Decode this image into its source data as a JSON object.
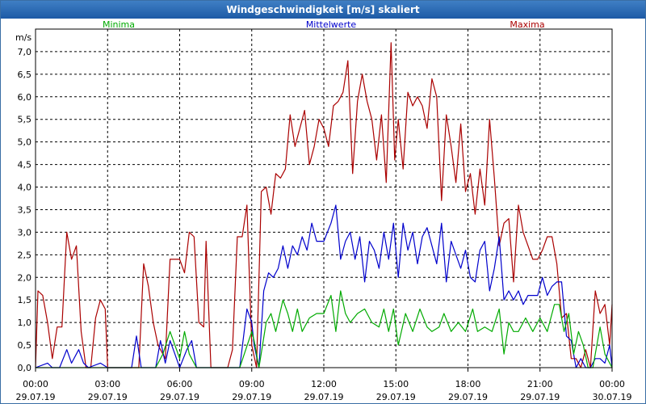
{
  "window": {
    "title": "Windgeschwindigkeit [m/s] skaliert"
  },
  "chart_data": {
    "type": "line",
    "title": "Windgeschwindigkeit [m/s] skaliert",
    "ylabel": "m/s",
    "xlabel": "",
    "ylim": [
      0,
      7.5
    ],
    "xlim": [
      0,
      24
    ],
    "grid": true,
    "legend_position": "top",
    "y_ticks": [
      "0,0",
      "0,5",
      "1,0",
      "1,5",
      "2,0",
      "2,5",
      "3,0",
      "3,5",
      "4,0",
      "4,5",
      "5,0",
      "5,5",
      "6,0",
      "6,5",
      "7,0"
    ],
    "x_ticks": [
      {
        "time": "00:00",
        "date": "29.07.19"
      },
      {
        "time": "03:00",
        "date": "29.07.19"
      },
      {
        "time": "06:00",
        "date": "29.07.19"
      },
      {
        "time": "09:00",
        "date": "29.07.19"
      },
      {
        "time": "12:00",
        "date": "29.07.19"
      },
      {
        "time": "15:00",
        "date": "29.07.19"
      },
      {
        "time": "18:00",
        "date": "29.07.19"
      },
      {
        "time": "21:00",
        "date": "29.07.19"
      },
      {
        "time": "00:00",
        "date": "30.07.19"
      }
    ],
    "series": [
      {
        "name": "Minima",
        "color": "#00aa00",
        "points": [
          [
            0,
            0
          ],
          [
            0.5,
            0
          ],
          [
            1.5,
            0
          ],
          [
            2,
            0
          ],
          [
            2.5,
            0
          ],
          [
            3,
            0
          ],
          [
            4,
            0
          ],
          [
            4.5,
            0
          ],
          [
            5,
            0
          ],
          [
            5.3,
            0.3
          ],
          [
            5.6,
            0.8
          ],
          [
            5.8,
            0.5
          ],
          [
            6,
            0.2
          ],
          [
            6.2,
            0.8
          ],
          [
            6.4,
            0.3
          ],
          [
            6.7,
            0
          ],
          [
            7,
            0
          ],
          [
            8,
            0
          ],
          [
            8.5,
            0
          ],
          [
            9,
            0.8
          ],
          [
            9.1,
            0.6
          ],
          [
            9.3,
            0
          ],
          [
            9.6,
            1
          ],
          [
            9.8,
            1.2
          ],
          [
            10,
            0.8
          ],
          [
            10.3,
            1.5
          ],
          [
            10.5,
            1.2
          ],
          [
            10.7,
            0.8
          ],
          [
            10.9,
            1.3
          ],
          [
            11.1,
            0.8
          ],
          [
            11.4,
            1.1
          ],
          [
            11.7,
            1.2
          ],
          [
            12,
            1.2
          ],
          [
            12.3,
            1.6
          ],
          [
            12.5,
            0.8
          ],
          [
            12.7,
            1.7
          ],
          [
            12.9,
            1.2
          ],
          [
            13.1,
            1
          ],
          [
            13.4,
            1.2
          ],
          [
            13.7,
            1.3
          ],
          [
            14,
            1
          ],
          [
            14.3,
            0.9
          ],
          [
            14.5,
            1.3
          ],
          [
            14.7,
            0.8
          ],
          [
            14.9,
            1.3
          ],
          [
            15.1,
            0.5
          ],
          [
            15.4,
            1.2
          ],
          [
            15.7,
            0.8
          ],
          [
            16,
            1.3
          ],
          [
            16.3,
            0.9
          ],
          [
            16.5,
            0.8
          ],
          [
            16.8,
            0.9
          ],
          [
            17,
            1.2
          ],
          [
            17.3,
            0.8
          ],
          [
            17.6,
            1
          ],
          [
            17.9,
            0.8
          ],
          [
            18.2,
            1.3
          ],
          [
            18.4,
            0.8
          ],
          [
            18.7,
            0.9
          ],
          [
            19,
            0.8
          ],
          [
            19.3,
            1.3
          ],
          [
            19.5,
            0.3
          ],
          [
            19.7,
            1
          ],
          [
            19.9,
            0.8
          ],
          [
            20.1,
            0.8
          ],
          [
            20.4,
            1.1
          ],
          [
            20.7,
            0.8
          ],
          [
            21,
            1.1
          ],
          [
            21.3,
            0.8
          ],
          [
            21.6,
            1.4
          ],
          [
            21.8,
            1.4
          ],
          [
            22,
            0.8
          ],
          [
            22.2,
            1.2
          ],
          [
            22.4,
            0.3
          ],
          [
            22.6,
            0.8
          ],
          [
            22.8,
            0.5
          ],
          [
            23,
            0
          ],
          [
            23.2,
            0
          ],
          [
            23.5,
            0.9
          ],
          [
            23.7,
            0.3
          ],
          [
            24,
            0
          ]
        ]
      },
      {
        "name": "Mittelwerte",
        "color": "#0000cc",
        "points": [
          [
            0,
            0
          ],
          [
            0.5,
            0.1
          ],
          [
            0.7,
            0
          ],
          [
            1,
            0
          ],
          [
            1.3,
            0.4
          ],
          [
            1.5,
            0.1
          ],
          [
            1.8,
            0.4
          ],
          [
            2,
            0.1
          ],
          [
            2.2,
            0
          ],
          [
            2.7,
            0.1
          ],
          [
            3,
            0
          ],
          [
            4,
            0
          ],
          [
            4.2,
            0.7
          ],
          [
            4.4,
            0
          ],
          [
            4.6,
            0
          ],
          [
            5,
            0
          ],
          [
            5.2,
            0.6
          ],
          [
            5.4,
            0.1
          ],
          [
            5.6,
            0.6
          ],
          [
            5.8,
            0.3
          ],
          [
            6,
            0
          ],
          [
            6.3,
            0.4
          ],
          [
            6.5,
            0.6
          ],
          [
            6.7,
            0
          ],
          [
            7,
            0
          ],
          [
            8,
            0
          ],
          [
            8.5,
            0
          ],
          [
            8.8,
            1.3
          ],
          [
            9,
            1
          ],
          [
            9.1,
            0.5
          ],
          [
            9.3,
            0
          ],
          [
            9.5,
            1.7
          ],
          [
            9.7,
            2.1
          ],
          [
            9.9,
            2
          ],
          [
            10.1,
            2.2
          ],
          [
            10.3,
            2.7
          ],
          [
            10.5,
            2.2
          ],
          [
            10.7,
            2.7
          ],
          [
            10.9,
            2.5
          ],
          [
            11.1,
            2.9
          ],
          [
            11.3,
            2.6
          ],
          [
            11.5,
            3.2
          ],
          [
            11.7,
            2.8
          ],
          [
            12,
            2.8
          ],
          [
            12.3,
            3.2
          ],
          [
            12.5,
            3.6
          ],
          [
            12.7,
            2.4
          ],
          [
            12.9,
            2.8
          ],
          [
            13.1,
            3
          ],
          [
            13.3,
            2.4
          ],
          [
            13.5,
            2.9
          ],
          [
            13.7,
            1.9
          ],
          [
            13.9,
            2.8
          ],
          [
            14.1,
            2.6
          ],
          [
            14.3,
            2.2
          ],
          [
            14.5,
            3
          ],
          [
            14.7,
            2.4
          ],
          [
            14.9,
            3.2
          ],
          [
            15.1,
            2
          ],
          [
            15.3,
            3.2
          ],
          [
            15.5,
            2.6
          ],
          [
            15.7,
            3
          ],
          [
            15.9,
            2.3
          ],
          [
            16.1,
            2.9
          ],
          [
            16.3,
            3.1
          ],
          [
            16.5,
            2.7
          ],
          [
            16.7,
            2.3
          ],
          [
            16.9,
            3.2
          ],
          [
            17.1,
            1.9
          ],
          [
            17.3,
            2.8
          ],
          [
            17.5,
            2.5
          ],
          [
            17.7,
            2.2
          ],
          [
            17.9,
            2.6
          ],
          [
            18.1,
            2
          ],
          [
            18.3,
            1.9
          ],
          [
            18.5,
            2.6
          ],
          [
            18.7,
            2.8
          ],
          [
            18.9,
            1.7
          ],
          [
            19.1,
            2.2
          ],
          [
            19.3,
            2.9
          ],
          [
            19.5,
            1.5
          ],
          [
            19.7,
            1.7
          ],
          [
            19.9,
            1.5
          ],
          [
            20.1,
            1.7
          ],
          [
            20.3,
            1.4
          ],
          [
            20.5,
            1.6
          ],
          [
            20.7,
            1.6
          ],
          [
            20.9,
            1.6
          ],
          [
            21.1,
            2
          ],
          [
            21.3,
            1.6
          ],
          [
            21.5,
            1.8
          ],
          [
            21.7,
            1.9
          ],
          [
            21.9,
            1.9
          ],
          [
            22.1,
            0.7
          ],
          [
            22.3,
            0.6
          ],
          [
            22.5,
            0
          ],
          [
            22.7,
            0.2
          ],
          [
            22.9,
            0
          ],
          [
            23.1,
            0
          ],
          [
            23.3,
            0.2
          ],
          [
            23.5,
            0.2
          ],
          [
            23.7,
            0.1
          ],
          [
            23.9,
            0.5
          ],
          [
            24,
            0
          ]
        ]
      },
      {
        "name": "Maxima",
        "color": "#aa0000",
        "points": [
          [
            0,
            0
          ],
          [
            0.1,
            1.7
          ],
          [
            0.3,
            1.6
          ],
          [
            0.5,
            1
          ],
          [
            0.7,
            0.2
          ],
          [
            0.9,
            0.9
          ],
          [
            1.1,
            0.9
          ],
          [
            1.3,
            3
          ],
          [
            1.5,
            2.4
          ],
          [
            1.7,
            2.7
          ],
          [
            1.9,
            0.8
          ],
          [
            2.1,
            0
          ],
          [
            2.3,
            0
          ],
          [
            2.5,
            1.1
          ],
          [
            2.7,
            1.5
          ],
          [
            2.9,
            1.3
          ],
          [
            3,
            0
          ],
          [
            3.5,
            0
          ],
          [
            4,
            0
          ],
          [
            4.3,
            0
          ],
          [
            4.5,
            2.3
          ],
          [
            4.7,
            1.8
          ],
          [
            4.9,
            1
          ],
          [
            5.1,
            0.5
          ],
          [
            5.4,
            0.2
          ],
          [
            5.6,
            2.4
          ],
          [
            5.8,
            2.4
          ],
          [
            6,
            2.4
          ],
          [
            6.2,
            2.1
          ],
          [
            6.4,
            3
          ],
          [
            6.6,
            2.9
          ],
          [
            6.8,
            1
          ],
          [
            7,
            0.9
          ],
          [
            7.1,
            2.8
          ],
          [
            7.3,
            0
          ],
          [
            7.6,
            0
          ],
          [
            8,
            0
          ],
          [
            8.2,
            0.4
          ],
          [
            8.4,
            2.9
          ],
          [
            8.6,
            2.9
          ],
          [
            8.8,
            3.6
          ],
          [
            9,
            0.5
          ],
          [
            9.2,
            0
          ],
          [
            9.4,
            3.9
          ],
          [
            9.6,
            4
          ],
          [
            9.8,
            3.4
          ],
          [
            10,
            4.3
          ],
          [
            10.2,
            4.2
          ],
          [
            10.4,
            4.4
          ],
          [
            10.6,
            5.6
          ],
          [
            10.8,
            4.9
          ],
          [
            11,
            5.3
          ],
          [
            11.2,
            5.7
          ],
          [
            11.4,
            4.5
          ],
          [
            11.6,
            4.9
          ],
          [
            11.8,
            5.5
          ],
          [
            12,
            5.3
          ],
          [
            12.2,
            4.9
          ],
          [
            12.4,
            5.8
          ],
          [
            12.6,
            5.9
          ],
          [
            12.8,
            6.1
          ],
          [
            13,
            6.8
          ],
          [
            13.2,
            4.3
          ],
          [
            13.4,
            5.9
          ],
          [
            13.6,
            6.5
          ],
          [
            13.8,
            5.9
          ],
          [
            14,
            5.5
          ],
          [
            14.2,
            4.6
          ],
          [
            14.4,
            5.6
          ],
          [
            14.6,
            4.1
          ],
          [
            14.8,
            7.2
          ],
          [
            14.95,
            4.6
          ],
          [
            15.1,
            5.5
          ],
          [
            15.3,
            4.4
          ],
          [
            15.5,
            6.1
          ],
          [
            15.7,
            5.8
          ],
          [
            15.9,
            6
          ],
          [
            16.1,
            5.8
          ],
          [
            16.3,
            5.3
          ],
          [
            16.5,
            6.4
          ],
          [
            16.7,
            6
          ],
          [
            16.9,
            3.7
          ],
          [
            17.1,
            5.6
          ],
          [
            17.3,
            4.9
          ],
          [
            17.5,
            4.1
          ],
          [
            17.7,
            5.4
          ],
          [
            17.9,
            3.9
          ],
          [
            18.1,
            4.3
          ],
          [
            18.3,
            3.4
          ],
          [
            18.5,
            4.4
          ],
          [
            18.7,
            3.6
          ],
          [
            18.9,
            5.5
          ],
          [
            19.1,
            4.2
          ],
          [
            19.3,
            2.7
          ],
          [
            19.5,
            3.2
          ],
          [
            19.7,
            3.3
          ],
          [
            19.9,
            1.9
          ],
          [
            20.1,
            3.6
          ],
          [
            20.3,
            3
          ],
          [
            20.5,
            2.7
          ],
          [
            20.7,
            2.4
          ],
          [
            20.9,
            2.4
          ],
          [
            21.1,
            2.6
          ],
          [
            21.3,
            2.9
          ],
          [
            21.5,
            2.9
          ],
          [
            21.7,
            2.3
          ],
          [
            21.9,
            1.1
          ],
          [
            22.1,
            1.2
          ],
          [
            22.3,
            0.2
          ],
          [
            22.5,
            0.2
          ],
          [
            22.7,
            0
          ],
          [
            22.9,
            0.4
          ],
          [
            23.1,
            0
          ],
          [
            23.3,
            1.7
          ],
          [
            23.5,
            1.2
          ],
          [
            23.7,
            1.4
          ],
          [
            23.9,
            0.5
          ],
          [
            24,
            1.4
          ]
        ]
      }
    ]
  }
}
